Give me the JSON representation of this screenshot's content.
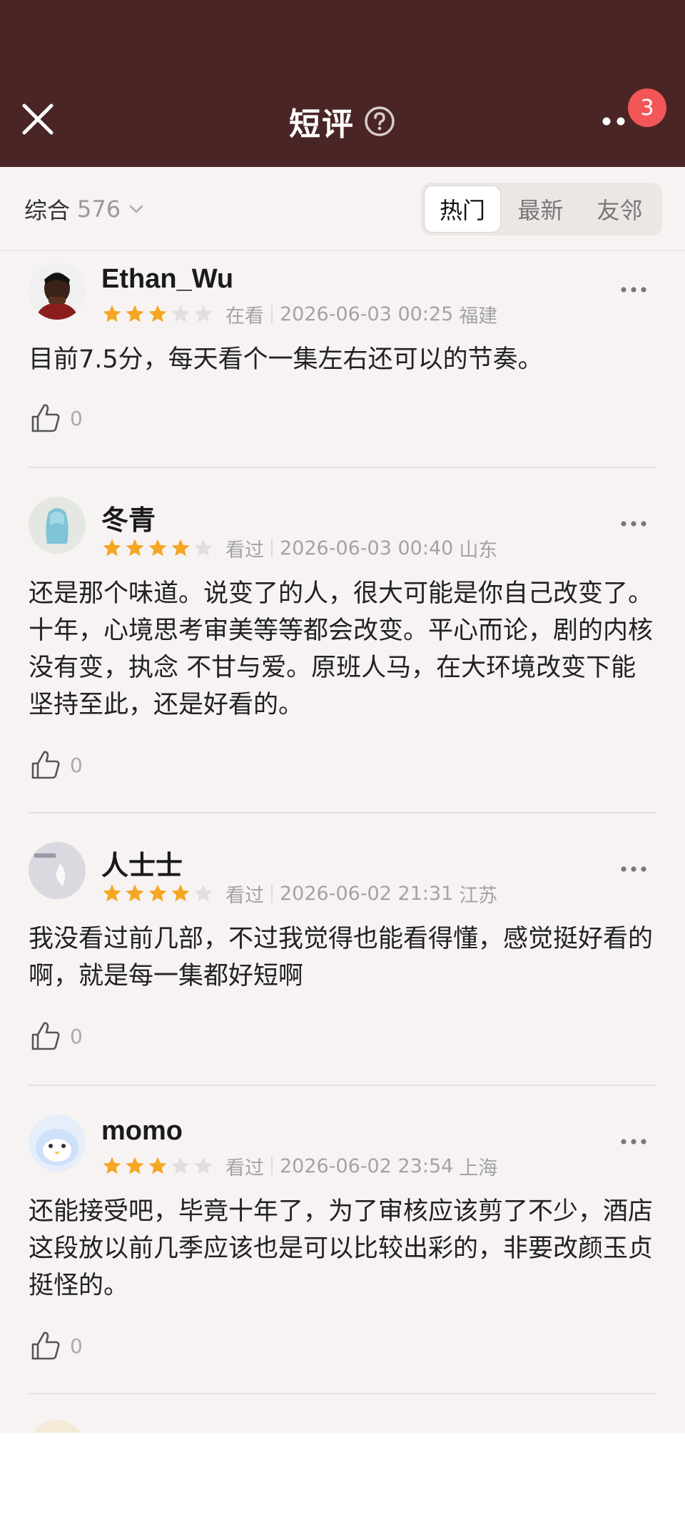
{
  "header": {
    "title": "短评",
    "notification_count": "3",
    "background_color": "#4a2525"
  },
  "filter": {
    "sort_label": "综合",
    "count": "576",
    "tabs": [
      {
        "label": "热门",
        "active": true
      },
      {
        "label": "最新",
        "active": false
      },
      {
        "label": "友邻",
        "active": false
      }
    ]
  },
  "reviews": [
    {
      "author": "Ethan_Wu",
      "rating": 3,
      "status": "在看",
      "datetime": "2026-06-03 00:25",
      "location": "福建",
      "text": "目前7.5分，每天看个一集左右还可以的节奏。",
      "likes": "0"
    },
    {
      "author": "冬青",
      "rating": 4,
      "status": "看过",
      "datetime": "2026-06-03 00:40",
      "location": "山东",
      "text": "还是那个味道。说变了的人，很大可能是你自己改变了。十年，心境思考审美等等都会改变。平心而论，剧的内核没有变，执念 不甘与爱。原班人马，在大环境改变下能坚持至此，还是好看的。",
      "likes": "0"
    },
    {
      "author": "人士士",
      "rating": 4,
      "status": "看过",
      "datetime": "2026-06-02 21:31",
      "location": "江苏",
      "text": "我没看过前几部，不过我觉得也能看得懂，感觉挺好看的啊，就是每一集都好短啊",
      "likes": "0"
    },
    {
      "author": "momo",
      "rating": 3,
      "status": "看过",
      "datetime": "2026-06-02 23:54",
      "location": "上海",
      "text": "还能接受吧，毕竟十年了，为了审核应该剪了不少，酒店这段放以前几季应该也是可以比较出彩的，非要改颜玉贞挺怪的。",
      "likes": "0"
    }
  ],
  "colors": {
    "star_filled": "#f5a623",
    "star_empty": "#e2dede",
    "badge": "#f25656"
  }
}
